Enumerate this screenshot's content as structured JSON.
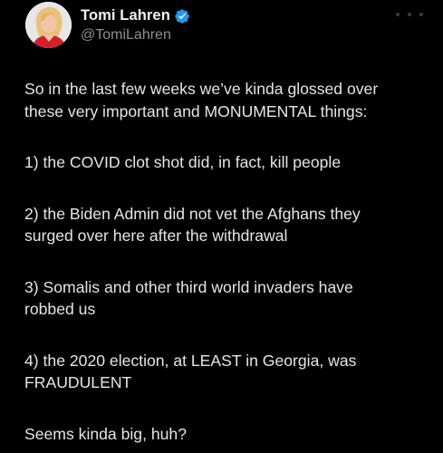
{
  "author": {
    "display_name": "Tomi Lahren",
    "handle": "@TomiLahren",
    "verified": true,
    "avatar": "avatar-photo"
  },
  "tweet": {
    "paragraphs": [
      [
        "So in the last few weeks we’ve kinda glossed over",
        "these very important and MONUMENTAL things:"
      ],
      [
        "1) the COVID clot shot did, in fact, kill people"
      ],
      [
        "2) the Biden Admin did not vet the Afghans they",
        "surged over here after the withdrawal"
      ],
      [
        "3) Somalis and other third world invaders have",
        "robbed us"
      ],
      [
        "4) the 2020 election, at LEAST in Georgia, was",
        "FRAUDULENT"
      ],
      [
        "Seems kinda big, huh?"
      ]
    ]
  },
  "colors": {
    "background": "#000000",
    "text": "#e7e9ea",
    "secondary": "#71767b",
    "verified": "#1d9bf0"
  },
  "icons": [
    "verified-badge-icon",
    "more-icon"
  ]
}
